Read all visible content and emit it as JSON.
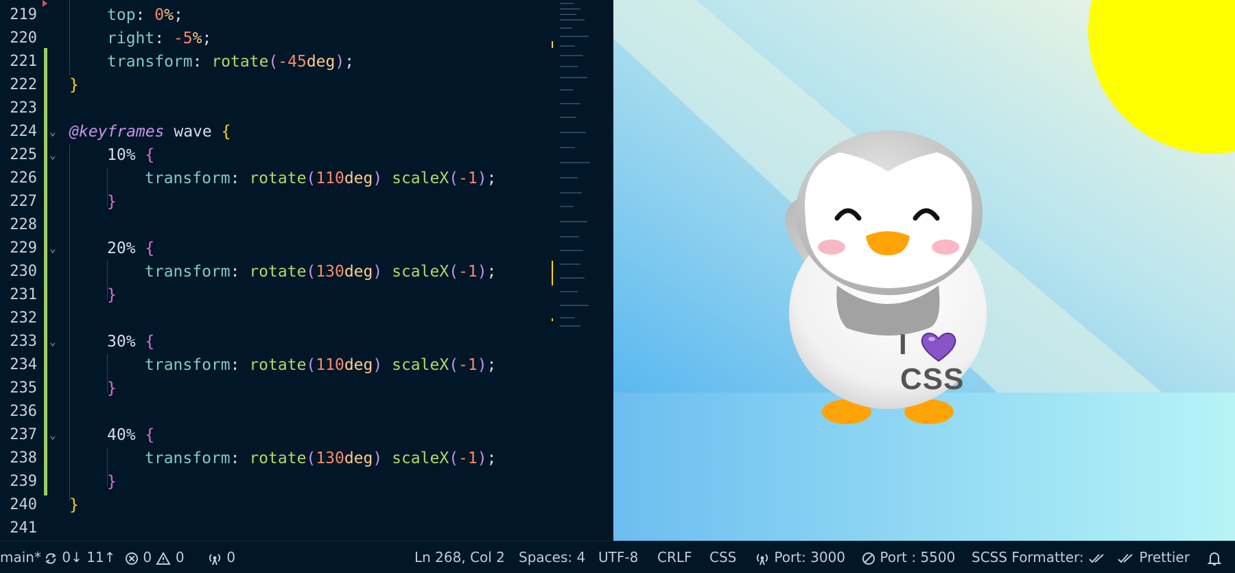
{
  "editor": {
    "lines": [
      {
        "num": "219",
        "text": "top: 0%;"
      },
      {
        "num": "220",
        "text": "right: -5%;"
      },
      {
        "num": "221",
        "text": "transform: rotate(-45deg);"
      },
      {
        "num": "222",
        "text": "}"
      },
      {
        "num": "223",
        "text": ""
      },
      {
        "num": "224",
        "text": "@keyframes wave {"
      },
      {
        "num": "225",
        "text": "10% {"
      },
      {
        "num": "226",
        "text": "transform: rotate(110deg) scaleX(-1);"
      },
      {
        "num": "227",
        "text": "}"
      },
      {
        "num": "228",
        "text": ""
      },
      {
        "num": "229",
        "text": "20% {"
      },
      {
        "num": "230",
        "text": "transform: rotate(130deg) scaleX(-1);"
      },
      {
        "num": "231",
        "text": "}"
      },
      {
        "num": "232",
        "text": ""
      },
      {
        "num": "233",
        "text": "30% {"
      },
      {
        "num": "234",
        "text": "transform: rotate(110deg) scaleX(-1);"
      },
      {
        "num": "235",
        "text": "}"
      },
      {
        "num": "236",
        "text": ""
      },
      {
        "num": "237",
        "text": "40% {"
      },
      {
        "num": "238",
        "text": "transform: rotate(130deg) scaleX(-1);"
      },
      {
        "num": "239",
        "text": "}"
      },
      {
        "num": "240",
        "text": "}"
      },
      {
        "num": "241",
        "text": ""
      }
    ],
    "tokens": {
      "top": "top",
      "right": "right",
      "transform": "transform",
      "colon": ": ",
      "zero": "0",
      "pct": "%",
      "semi": ";",
      "neg5": "-5",
      "rotate": "rotate",
      "scaleX": "scaleX",
      "open": "(",
      "close": ")",
      "neg45": "-45",
      "deg": "deg",
      "n110": "110",
      "n130": "130",
      "neg1": "-1",
      "brace_open": "{",
      "brace_close": "}",
      "at_keyframes": "@keyframes",
      "wave": "wave",
      "p10": "10%",
      "p20": "20%",
      "p30": "30%",
      "p40": "40%",
      "space": " "
    }
  },
  "preview": {
    "shirt_text_1": "I",
    "shirt_text_2": "CSS",
    "heart_icon": "purple-heart"
  },
  "statusbar": {
    "branch": "main*",
    "sync": "0↓ 11↑",
    "errors": "0",
    "warnings": "0",
    "ports_count": "0",
    "cursor": "Ln 268, Col 2",
    "spaces": "Spaces: 4",
    "encoding": "UTF-8",
    "eol": "CRLF",
    "language": "CSS",
    "port_dev": "Port: 3000",
    "port_live": "Port : 5500",
    "formatter": "SCSS Formatter:",
    "prettier": "Prettier"
  },
  "colors": {
    "editor_bg": "#011627",
    "git_added": "#9ccc65",
    "sun": "#ffff00",
    "floor": "#7ec8ee"
  }
}
